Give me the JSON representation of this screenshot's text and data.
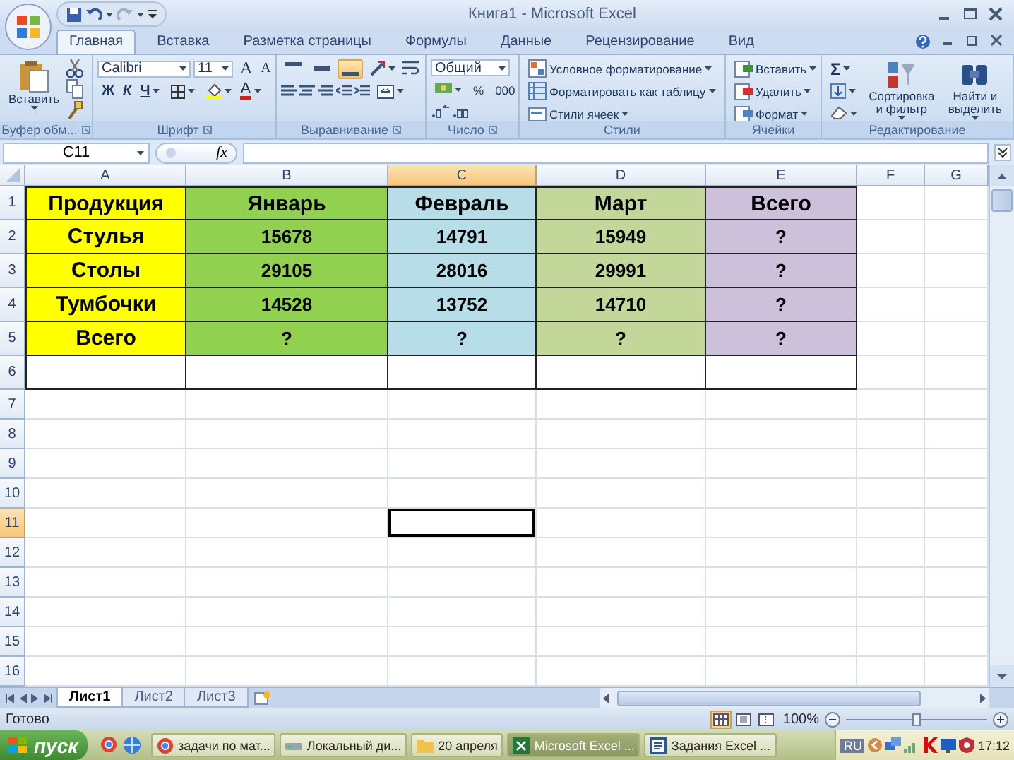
{
  "title_bar": {
    "title": "Книга1 - Microsoft Excel"
  },
  "ribbon_tabs": [
    {
      "label": "Главная",
      "selected": true
    },
    {
      "label": "Вставка",
      "selected": false
    },
    {
      "label": "Разметка страницы",
      "selected": false
    },
    {
      "label": "Формулы",
      "selected": false
    },
    {
      "label": "Данные",
      "selected": false
    },
    {
      "label": "Рецензирование",
      "selected": false
    },
    {
      "label": "Вид",
      "selected": false
    }
  ],
  "ribbon_groups": [
    {
      "kind": "clipboard",
      "label": "Буфер обм...",
      "paste": "Вставить"
    },
    {
      "kind": "font",
      "label": "Шрифт",
      "font_name": "Calibri",
      "font_size": "11",
      "grow": "A",
      "shrink": "A",
      "bold": "Ж",
      "italic": "К",
      "underline": "Ч",
      "font_color": "A"
    },
    {
      "kind": "alignment",
      "label": "Выравнивание",
      "vertical_align": [
        {
          "selected": false
        },
        {
          "selected": false
        },
        {
          "selected": true
        }
      ]
    },
    {
      "kind": "number",
      "label": "Число",
      "format": "Общий",
      "percent": "%",
      "thousands": "000"
    },
    {
      "kind": "styles",
      "label": "Стили",
      "items": [
        "Условное форматирование",
        "Форматировать как таблицу",
        "Стили ячеек"
      ]
    },
    {
      "kind": "cells",
      "label": "Ячейки",
      "items": [
        "Вставить",
        "Удалить",
        "Формат"
      ]
    },
    {
      "kind": "editing",
      "label": "Редактирование",
      "sum": "Σ",
      "sort": "Сортировка и фильтр",
      "find": "Найти и выделить"
    }
  ],
  "formula_bar": {
    "name_box": "C11",
    "function_label": "fx"
  },
  "columns": [
    {
      "label": "A",
      "selected": false
    },
    {
      "label": "B",
      "selected": false
    },
    {
      "label": "C",
      "selected": true
    },
    {
      "label": "D",
      "selected": false
    },
    {
      "label": "E",
      "selected": false
    },
    {
      "label": "F",
      "selected": false
    },
    {
      "label": "G",
      "selected": false
    }
  ],
  "rows": [
    {
      "label": "1",
      "selected": false,
      "bordered": true,
      "cells": [
        {
          "text": "Продукция",
          "color": "#ffff00"
        },
        {
          "text": "Январь",
          "color": "#92d050"
        },
        {
          "text": "Февраль",
          "color": "#b7dee8"
        },
        {
          "text": "Март",
          "color": "#c4d79b"
        },
        {
          "text": "Всего",
          "color": "#ccc0da"
        }
      ]
    },
    {
      "label": "2",
      "selected": false,
      "bordered": true,
      "cells": [
        {
          "text": "Стулья",
          "color": "#ffff00"
        },
        {
          "text": "15678",
          "color": "#92d050"
        },
        {
          "text": "14791",
          "color": "#b7dee8"
        },
        {
          "text": "15949",
          "color": "#c4d79b"
        },
        {
          "text": "?",
          "color": "#ccc0da"
        }
      ]
    },
    {
      "label": "3",
      "selected": false,
      "bordered": true,
      "cells": [
        {
          "text": "Столы",
          "color": "#ffff00"
        },
        {
          "text": "29105",
          "color": "#92d050"
        },
        {
          "text": "28016",
          "color": "#b7dee8"
        },
        {
          "text": "29991",
          "color": "#c4d79b"
        },
        {
          "text": "?",
          "color": "#ccc0da"
        }
      ]
    },
    {
      "label": "4",
      "selected": false,
      "bordered": true,
      "cells": [
        {
          "text": "Тумбочки",
          "color": "#ffff00"
        },
        {
          "text": "14528",
          "color": "#92d050"
        },
        {
          "text": "13752",
          "color": "#b7dee8"
        },
        {
          "text": "14710",
          "color": "#c4d79b"
        },
        {
          "text": "?",
          "color": "#ccc0da"
        }
      ]
    },
    {
      "label": "5",
      "selected": false,
      "bordered": true,
      "cells": [
        {
          "text": "Всего",
          "color": "#ffff00"
        },
        {
          "text": "?",
          "color": "#92d050"
        },
        {
          "text": "?",
          "color": "#b7dee8"
        },
        {
          "text": "?",
          "color": "#c4d79b"
        },
        {
          "text": "?",
          "color": "#ccc0da"
        }
      ]
    },
    {
      "label": "6",
      "selected": false,
      "bordered": true
    },
    {
      "label": "7",
      "selected": false,
      "bordered": false
    },
    {
      "label": "8",
      "selected": false,
      "bordered": false
    },
    {
      "label": "9",
      "selected": false,
      "bordered": false
    },
    {
      "label": "10",
      "selected": false,
      "bordered": false
    },
    {
      "label": "11",
      "selected": true,
      "bordered": false
    },
    {
      "label": "12",
      "selected": false,
      "bordered": false
    },
    {
      "label": "13",
      "selected": false,
      "bordered": false
    },
    {
      "label": "14",
      "selected": false,
      "bordered": false
    },
    {
      "label": "15",
      "selected": false,
      "bordered": false
    },
    {
      "label": "16",
      "selected": false,
      "bordered": false
    }
  ],
  "sheet_tabs": [
    {
      "label": "Лист1",
      "selected": true
    },
    {
      "label": "Лист2",
      "selected": false
    },
    {
      "label": "Лист3",
      "selected": false
    }
  ],
  "status_bar": {
    "status": "Готово",
    "views": [
      {
        "selected": true
      },
      {
        "selected": false
      },
      {
        "selected": false
      }
    ],
    "zoom": "100%",
    "zoom_slider": {
      "level": 0.5
    }
  },
  "taskbar": {
    "start": "пуск",
    "tasks": [
      {
        "label": "задачи по мат...",
        "kind": "browser",
        "selected": false
      },
      {
        "label": "Локальный ди...",
        "kind": "drive",
        "selected": false
      },
      {
        "label": "20 апреля",
        "kind": "folder",
        "selected": false
      },
      {
        "label": "Microsoft Excel ...",
        "kind": "spreadsheet",
        "selected": true
      },
      {
        "label": "Задания Excel ...",
        "kind": "document",
        "selected": false
      }
    ],
    "language": "RU",
    "time": "17:12"
  }
}
